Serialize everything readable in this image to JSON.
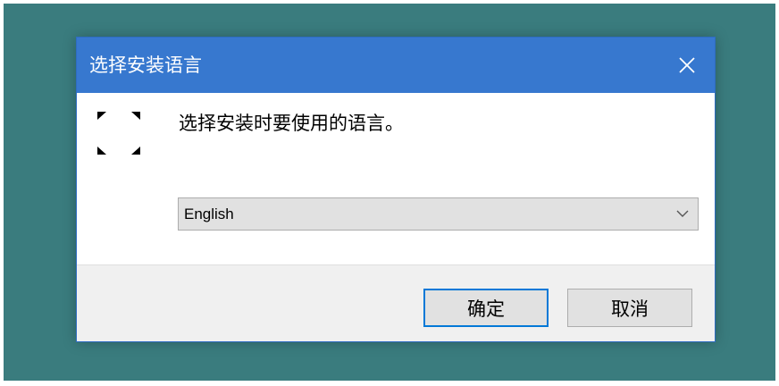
{
  "dialog": {
    "title": "选择安装语言",
    "prompt": "选择安装时要使用的语言。",
    "language_select": {
      "selected": "English"
    },
    "ok_label": "确定",
    "cancel_label": "取消"
  },
  "icons": {
    "app": "installer-app-icon",
    "close": "close-icon",
    "dropdown": "chevron-down-icon"
  },
  "colors": {
    "desktop": "#3a7c7e",
    "titlebar": "#3778cf",
    "focus_border": "#0078d7"
  }
}
